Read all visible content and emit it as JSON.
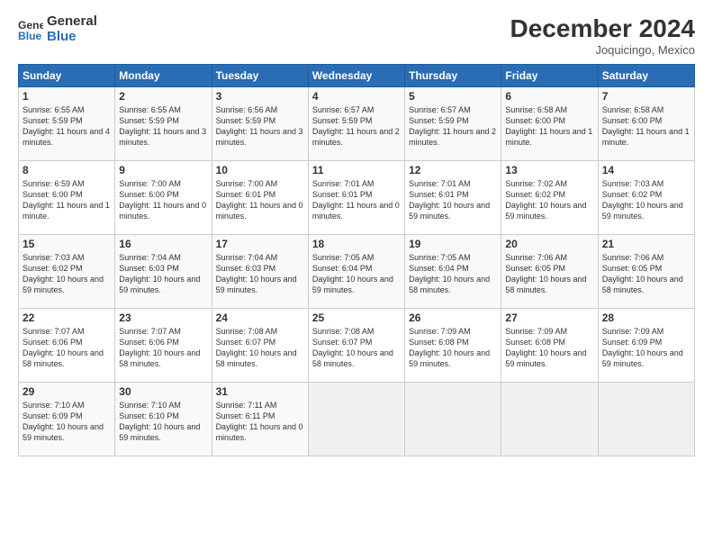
{
  "header": {
    "logo_general": "General",
    "logo_blue": "Blue",
    "month_title": "December 2024",
    "location": "Joquicingo, Mexico"
  },
  "days_of_week": [
    "Sunday",
    "Monday",
    "Tuesday",
    "Wednesday",
    "Thursday",
    "Friday",
    "Saturday"
  ],
  "weeks": [
    [
      {
        "day": 1,
        "sunrise": "6:55 AM",
        "sunset": "5:59 PM",
        "daylight": "11 hours and 4 minutes."
      },
      {
        "day": 2,
        "sunrise": "6:55 AM",
        "sunset": "5:59 PM",
        "daylight": "11 hours and 3 minutes."
      },
      {
        "day": 3,
        "sunrise": "6:56 AM",
        "sunset": "5:59 PM",
        "daylight": "11 hours and 3 minutes."
      },
      {
        "day": 4,
        "sunrise": "6:57 AM",
        "sunset": "5:59 PM",
        "daylight": "11 hours and 2 minutes."
      },
      {
        "day": 5,
        "sunrise": "6:57 AM",
        "sunset": "5:59 PM",
        "daylight": "11 hours and 2 minutes."
      },
      {
        "day": 6,
        "sunrise": "6:58 AM",
        "sunset": "6:00 PM",
        "daylight": "11 hours and 1 minute."
      },
      {
        "day": 7,
        "sunrise": "6:58 AM",
        "sunset": "6:00 PM",
        "daylight": "11 hours and 1 minute."
      }
    ],
    [
      {
        "day": 8,
        "sunrise": "6:59 AM",
        "sunset": "6:00 PM",
        "daylight": "11 hours and 1 minute."
      },
      {
        "day": 9,
        "sunrise": "7:00 AM",
        "sunset": "6:00 PM",
        "daylight": "11 hours and 0 minutes."
      },
      {
        "day": 10,
        "sunrise": "7:00 AM",
        "sunset": "6:01 PM",
        "daylight": "11 hours and 0 minutes."
      },
      {
        "day": 11,
        "sunrise": "7:01 AM",
        "sunset": "6:01 PM",
        "daylight": "11 hours and 0 minutes."
      },
      {
        "day": 12,
        "sunrise": "7:01 AM",
        "sunset": "6:01 PM",
        "daylight": "10 hours and 59 minutes."
      },
      {
        "day": 13,
        "sunrise": "7:02 AM",
        "sunset": "6:02 PM",
        "daylight": "10 hours and 59 minutes."
      },
      {
        "day": 14,
        "sunrise": "7:03 AM",
        "sunset": "6:02 PM",
        "daylight": "10 hours and 59 minutes."
      }
    ],
    [
      {
        "day": 15,
        "sunrise": "7:03 AM",
        "sunset": "6:02 PM",
        "daylight": "10 hours and 59 minutes."
      },
      {
        "day": 16,
        "sunrise": "7:04 AM",
        "sunset": "6:03 PM",
        "daylight": "10 hours and 59 minutes."
      },
      {
        "day": 17,
        "sunrise": "7:04 AM",
        "sunset": "6:03 PM",
        "daylight": "10 hours and 59 minutes."
      },
      {
        "day": 18,
        "sunrise": "7:05 AM",
        "sunset": "6:04 PM",
        "daylight": "10 hours and 59 minutes."
      },
      {
        "day": 19,
        "sunrise": "7:05 AM",
        "sunset": "6:04 PM",
        "daylight": "10 hours and 58 minutes."
      },
      {
        "day": 20,
        "sunrise": "7:06 AM",
        "sunset": "6:05 PM",
        "daylight": "10 hours and 58 minutes."
      },
      {
        "day": 21,
        "sunrise": "7:06 AM",
        "sunset": "6:05 PM",
        "daylight": "10 hours and 58 minutes."
      }
    ],
    [
      {
        "day": 22,
        "sunrise": "7:07 AM",
        "sunset": "6:06 PM",
        "daylight": "10 hours and 58 minutes."
      },
      {
        "day": 23,
        "sunrise": "7:07 AM",
        "sunset": "6:06 PM",
        "daylight": "10 hours and 58 minutes."
      },
      {
        "day": 24,
        "sunrise": "7:08 AM",
        "sunset": "6:07 PM",
        "daylight": "10 hours and 58 minutes."
      },
      {
        "day": 25,
        "sunrise": "7:08 AM",
        "sunset": "6:07 PM",
        "daylight": "10 hours and 58 minutes."
      },
      {
        "day": 26,
        "sunrise": "7:09 AM",
        "sunset": "6:08 PM",
        "daylight": "10 hours and 59 minutes."
      },
      {
        "day": 27,
        "sunrise": "7:09 AM",
        "sunset": "6:08 PM",
        "daylight": "10 hours and 59 minutes."
      },
      {
        "day": 28,
        "sunrise": "7:09 AM",
        "sunset": "6:09 PM",
        "daylight": "10 hours and 59 minutes."
      }
    ],
    [
      {
        "day": 29,
        "sunrise": "7:10 AM",
        "sunset": "6:09 PM",
        "daylight": "10 hours and 59 minutes."
      },
      {
        "day": 30,
        "sunrise": "7:10 AM",
        "sunset": "6:10 PM",
        "daylight": "10 hours and 59 minutes."
      },
      {
        "day": 31,
        "sunrise": "7:11 AM",
        "sunset": "6:11 PM",
        "daylight": "11 hours and 0 minutes."
      },
      null,
      null,
      null,
      null
    ]
  ]
}
